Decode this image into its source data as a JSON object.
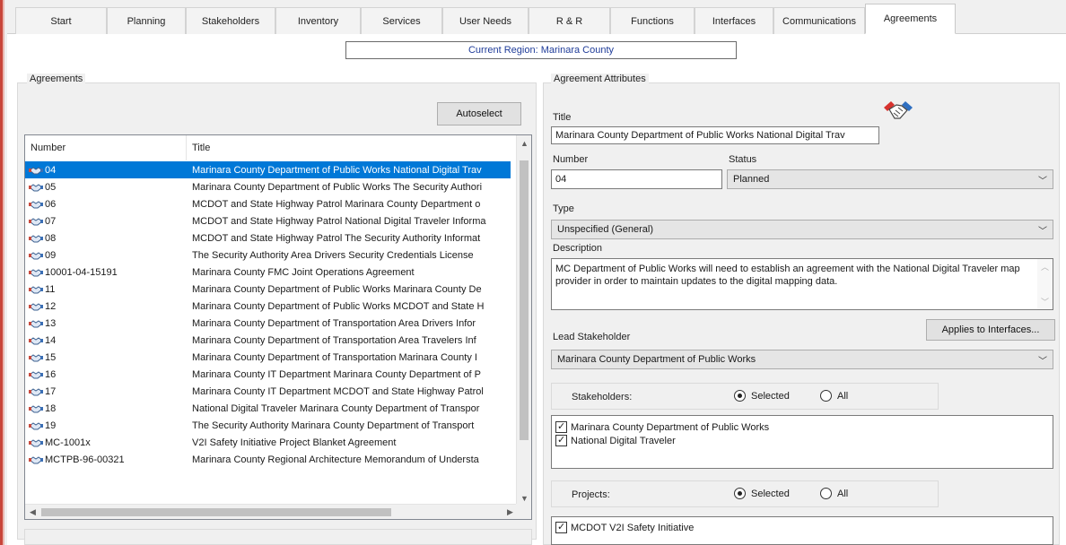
{
  "tabs": [
    {
      "label": "Start"
    },
    {
      "label": "Planning"
    },
    {
      "label": "Stakeholders"
    },
    {
      "label": "Inventory"
    },
    {
      "label": "Services"
    },
    {
      "label": "User Needs"
    },
    {
      "label": "R & R"
    },
    {
      "label": "Functions"
    },
    {
      "label": "Interfaces"
    },
    {
      "label": "Communications"
    },
    {
      "label": "Agreements"
    }
  ],
  "active_tab": "Agreements",
  "region": "Current Region: Marinara County",
  "agreements": {
    "group_label": "Agreements",
    "autoselect_label": "Autoselect",
    "columns": [
      "Number",
      "Title"
    ],
    "rows": [
      {
        "number": "04",
        "title": "Marinara County Department of Public Works National Digital Trav"
      },
      {
        "number": "05",
        "title": "Marinara County Department of Public Works The Security Authori"
      },
      {
        "number": "06",
        "title": "MCDOT and State Highway Patrol Marinara County Department o"
      },
      {
        "number": "07",
        "title": "MCDOT and State Highway Patrol National Digital Traveler Informa"
      },
      {
        "number": "08",
        "title": "MCDOT and State Highway Patrol The Security Authority Informat"
      },
      {
        "number": "09",
        "title": "The Security Authority Area Drivers Security Credentials License"
      },
      {
        "number": "10001-04-15191",
        "title": "Marinara County FMC Joint Operations Agreement"
      },
      {
        "number": "11",
        "title": "Marinara County Department of Public Works Marinara County De"
      },
      {
        "number": "12",
        "title": "Marinara County Department of Public Works MCDOT and State H"
      },
      {
        "number": "13",
        "title": "Marinara County Department of Transportation Area Drivers Infor"
      },
      {
        "number": "14",
        "title": "Marinara County Department of Transportation Area Travelers Inf"
      },
      {
        "number": "15",
        "title": "Marinara County Department of Transportation Marinara County I"
      },
      {
        "number": "16",
        "title": "Marinara County IT Department Marinara County Department of P"
      },
      {
        "number": "17",
        "title": "Marinara County IT Department MCDOT and State Highway Patrol"
      },
      {
        "number": "18",
        "title": "National Digital Traveler Marinara County Department of Transpor"
      },
      {
        "number": "19",
        "title": "The Security Authority Marinara County Department of Transport"
      },
      {
        "number": "MC-1001x",
        "title": "V2I Safety Initiative Project Blanket Agreement"
      },
      {
        "number": "MCTPB-96-00321",
        "title": "Marinara County Regional Architecture Memorandum of Understa"
      }
    ],
    "selected_index": 0
  },
  "attributes": {
    "group_label": "Agreement Attributes",
    "title_label": "Title",
    "title_value": "Marinara County Department of Public Works National Digital Trav",
    "number_label": "Number",
    "number_value": "04",
    "status_label": "Status",
    "status_value": "Planned",
    "type_label": "Type",
    "type_value": "Unspecified (General)",
    "description_label": "Description",
    "description_value": "MC Department of Public Works will need to establish an agreement with the National Digital Traveler map provider in order to maintain updates to the digital mapping data.",
    "applies_button": "Applies to Interfaces...",
    "lead_label": "Lead Stakeholder",
    "lead_value": "Marinara County Department of Public Works",
    "stakeholders_label": "Stakeholders:",
    "selected_label": "Selected",
    "all_label": "All",
    "stakeholders": [
      "Marinara County Department of Public Works",
      "National Digital Traveler"
    ],
    "projects_label": "Projects:",
    "projects": [
      "MCDOT V2I Safety Initiative"
    ],
    "handshake_icon": "handshake-icon"
  }
}
